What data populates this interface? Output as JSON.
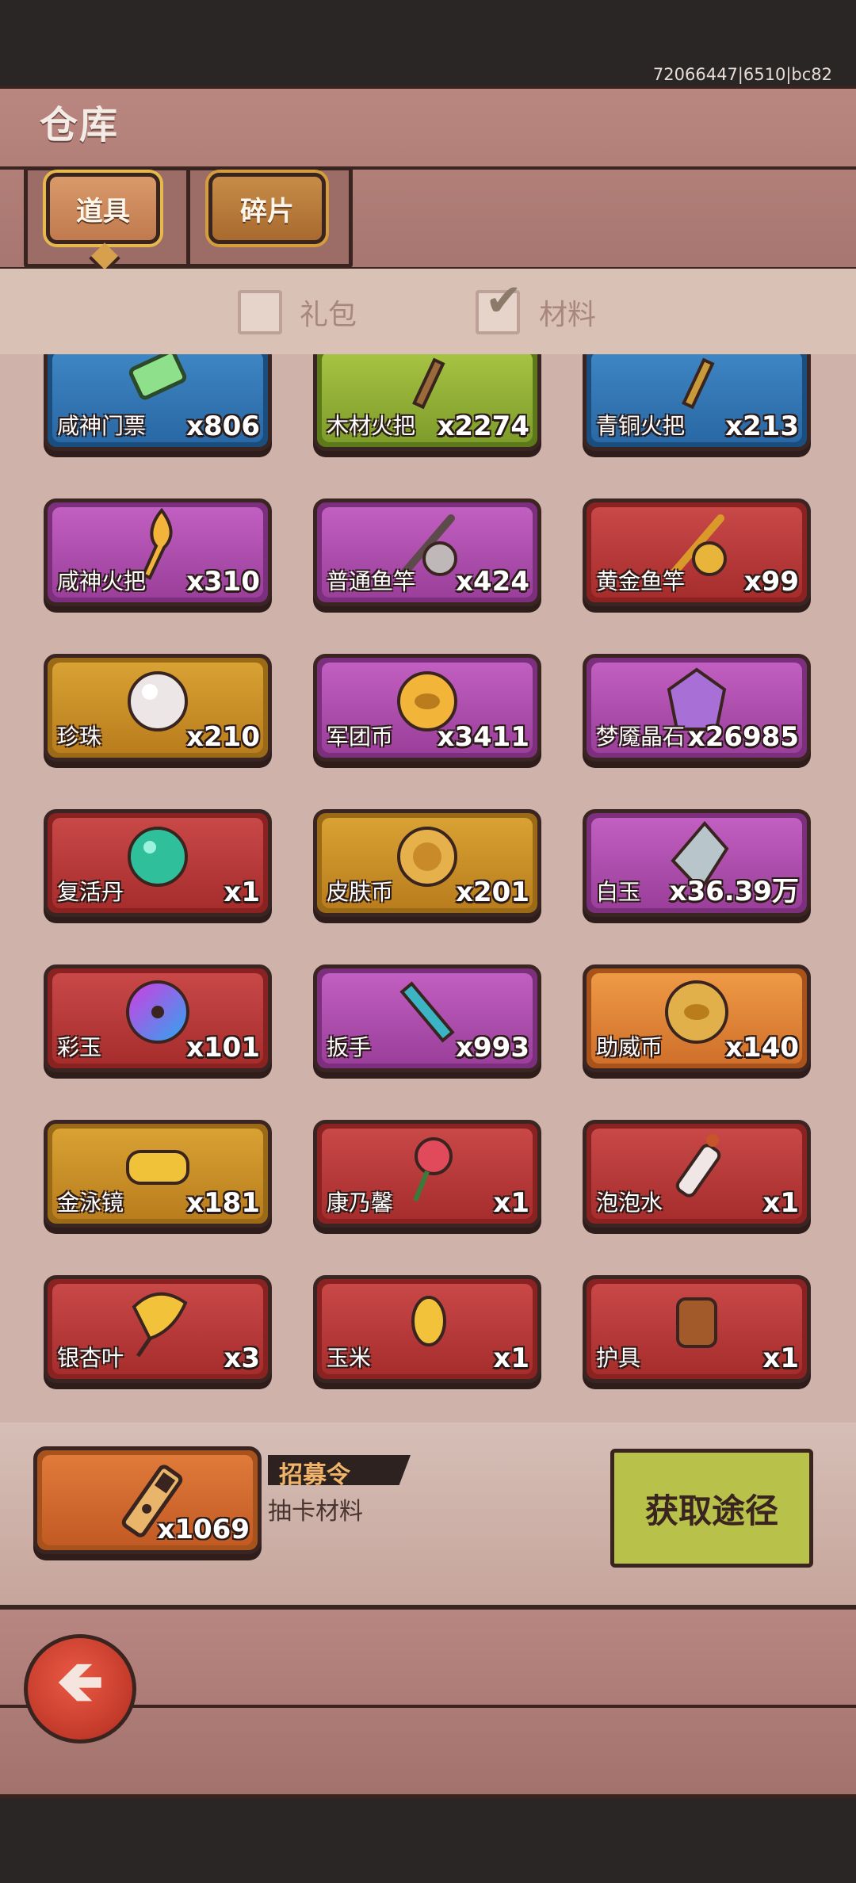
{
  "status": {
    "build_id": "72066447|6510|bc82"
  },
  "header": {
    "title": "仓库"
  },
  "tabs": [
    {
      "label": "道具",
      "selected": true
    },
    {
      "label": "碎片",
      "selected": false
    }
  ],
  "filters": [
    {
      "label": "礼包",
      "checked": false
    },
    {
      "label": "材料",
      "checked": true
    }
  ],
  "items": [
    {
      "name": "咸神门票",
      "qty": "x806",
      "rarity": "blue",
      "icon": "ticket-icon"
    },
    {
      "name": "木材火把",
      "qty": "x2274",
      "rarity": "green",
      "icon": "wood-torch-icon"
    },
    {
      "name": "青铜火把",
      "qty": "x213",
      "rarity": "blue",
      "icon": "bronze-torch-icon"
    },
    {
      "name": "咸神火把",
      "qty": "x310",
      "rarity": "purple",
      "icon": "flame-torch-icon"
    },
    {
      "name": "普通鱼竿",
      "qty": "x424",
      "rarity": "purple",
      "icon": "fishing-rod-icon"
    },
    {
      "name": "黄金鱼竿",
      "qty": "x99",
      "rarity": "red",
      "icon": "gold-fishing-rod-icon"
    },
    {
      "name": "珍珠",
      "qty": "x210",
      "rarity": "gold",
      "icon": "pearl-icon"
    },
    {
      "name": "军团币",
      "qty": "x3411",
      "rarity": "purple",
      "icon": "legion-coin-icon"
    },
    {
      "name": "梦魇晶石",
      "qty": "x26985",
      "rarity": "purple",
      "icon": "crystal-icon"
    },
    {
      "name": "复活丹",
      "qty": "x1",
      "rarity": "red",
      "icon": "revive-pill-icon"
    },
    {
      "name": "皮肤币",
      "qty": "x201",
      "rarity": "gold",
      "icon": "skin-coin-icon"
    },
    {
      "name": "白玉",
      "qty": "x36.39万",
      "rarity": "purple",
      "icon": "white-jade-icon"
    },
    {
      "name": "彩玉",
      "qty": "x101",
      "rarity": "red",
      "icon": "rainbow-jade-icon"
    },
    {
      "name": "扳手",
      "qty": "x993",
      "rarity": "purple",
      "icon": "wrench-icon"
    },
    {
      "name": "助威币",
      "qty": "x140",
      "rarity": "orange",
      "icon": "cheer-coin-icon"
    },
    {
      "name": "金泳镜",
      "qty": "x181",
      "rarity": "gold",
      "icon": "goggles-icon"
    },
    {
      "name": "康乃馨",
      "qty": "x1",
      "rarity": "red",
      "icon": "carnation-icon"
    },
    {
      "name": "泡泡水",
      "qty": "x1",
      "rarity": "red",
      "icon": "bubble-water-icon"
    },
    {
      "name": "银杏叶",
      "qty": "x3",
      "rarity": "red",
      "icon": "ginkgo-leaf-icon"
    },
    {
      "name": "玉米",
      "qty": "x1",
      "rarity": "red",
      "icon": "corn-icon"
    },
    {
      "name": "护具",
      "qty": "x1",
      "rarity": "red",
      "icon": "armor-icon"
    }
  ],
  "partial_row": [
    {
      "rarity": "purple"
    },
    {
      "rarity": "red"
    },
    {
      "rarity": "red"
    }
  ],
  "detail": {
    "name": "招募令",
    "desc": "抽卡材料",
    "qty": "x1069",
    "rarity": "orange",
    "icon": "recruit-token-icon",
    "action_label": "获取途径"
  },
  "footer": {
    "back_icon": "back-arrow-icon"
  }
}
